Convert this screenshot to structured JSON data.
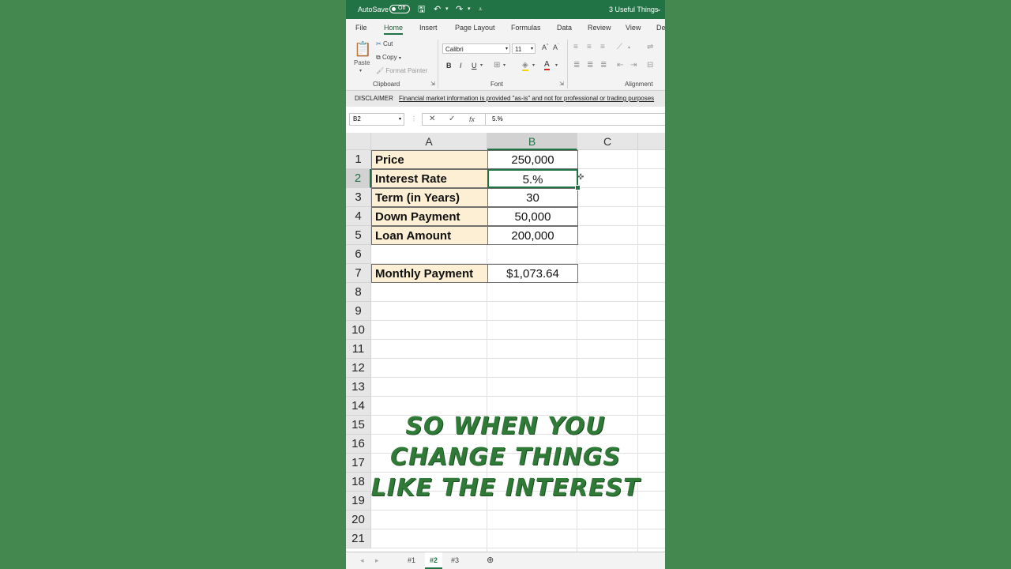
{
  "title_bar": {
    "autosave_label": "AutoSave",
    "autosave_state": "Off",
    "doc_title": "3 Useful Things"
  },
  "menu_tabs": [
    "File",
    "Home",
    "Insert",
    "Page Layout",
    "Formulas",
    "Data",
    "Review",
    "View",
    "De"
  ],
  "ribbon": {
    "clipboard": {
      "paste": "Paste",
      "cut": "Cut",
      "copy": "Copy",
      "format_painter": "Format Painter",
      "group_label": "Clipboard"
    },
    "font": {
      "font_name": "Calibri",
      "font_size": "11",
      "group_label": "Font"
    },
    "alignment": {
      "group_label": "Alignment"
    }
  },
  "disclaimer": {
    "title": "DISCLAIMER",
    "message": "Financial market information is provided \"as-is\" and not for professional or trading purposes"
  },
  "formula_bar": {
    "name_box": "B2",
    "formula": "5.%",
    "fx": "fx"
  },
  "columns": [
    "A",
    "B",
    "C"
  ],
  "rows": [
    "1",
    "2",
    "3",
    "4",
    "5",
    "6",
    "7",
    "8",
    "9",
    "10",
    "11",
    "12",
    "13",
    "14",
    "15",
    "16",
    "17",
    "18",
    "19",
    "20",
    "21"
  ],
  "cells": [
    {
      "label": "Price",
      "value": "250,000"
    },
    {
      "label": "Interest Rate",
      "value": "5.%"
    },
    {
      "label": "Term (in Years)",
      "value": "30"
    },
    {
      "label": "Down Payment",
      "value": "50,000"
    },
    {
      "label": "Loan Amount",
      "value": "200,000"
    },
    {
      "label": "Monthly Payment",
      "value": "$1,073.64"
    }
  ],
  "sheet_tabs": [
    "#1",
    "#2",
    "#3"
  ],
  "caption": [
    "So when you",
    "change things",
    "like the interest"
  ],
  "colors": {
    "excel_green": "#217346",
    "background": "#44874f",
    "label_fill": "#fcefd3",
    "caption": "#2f7a37"
  }
}
